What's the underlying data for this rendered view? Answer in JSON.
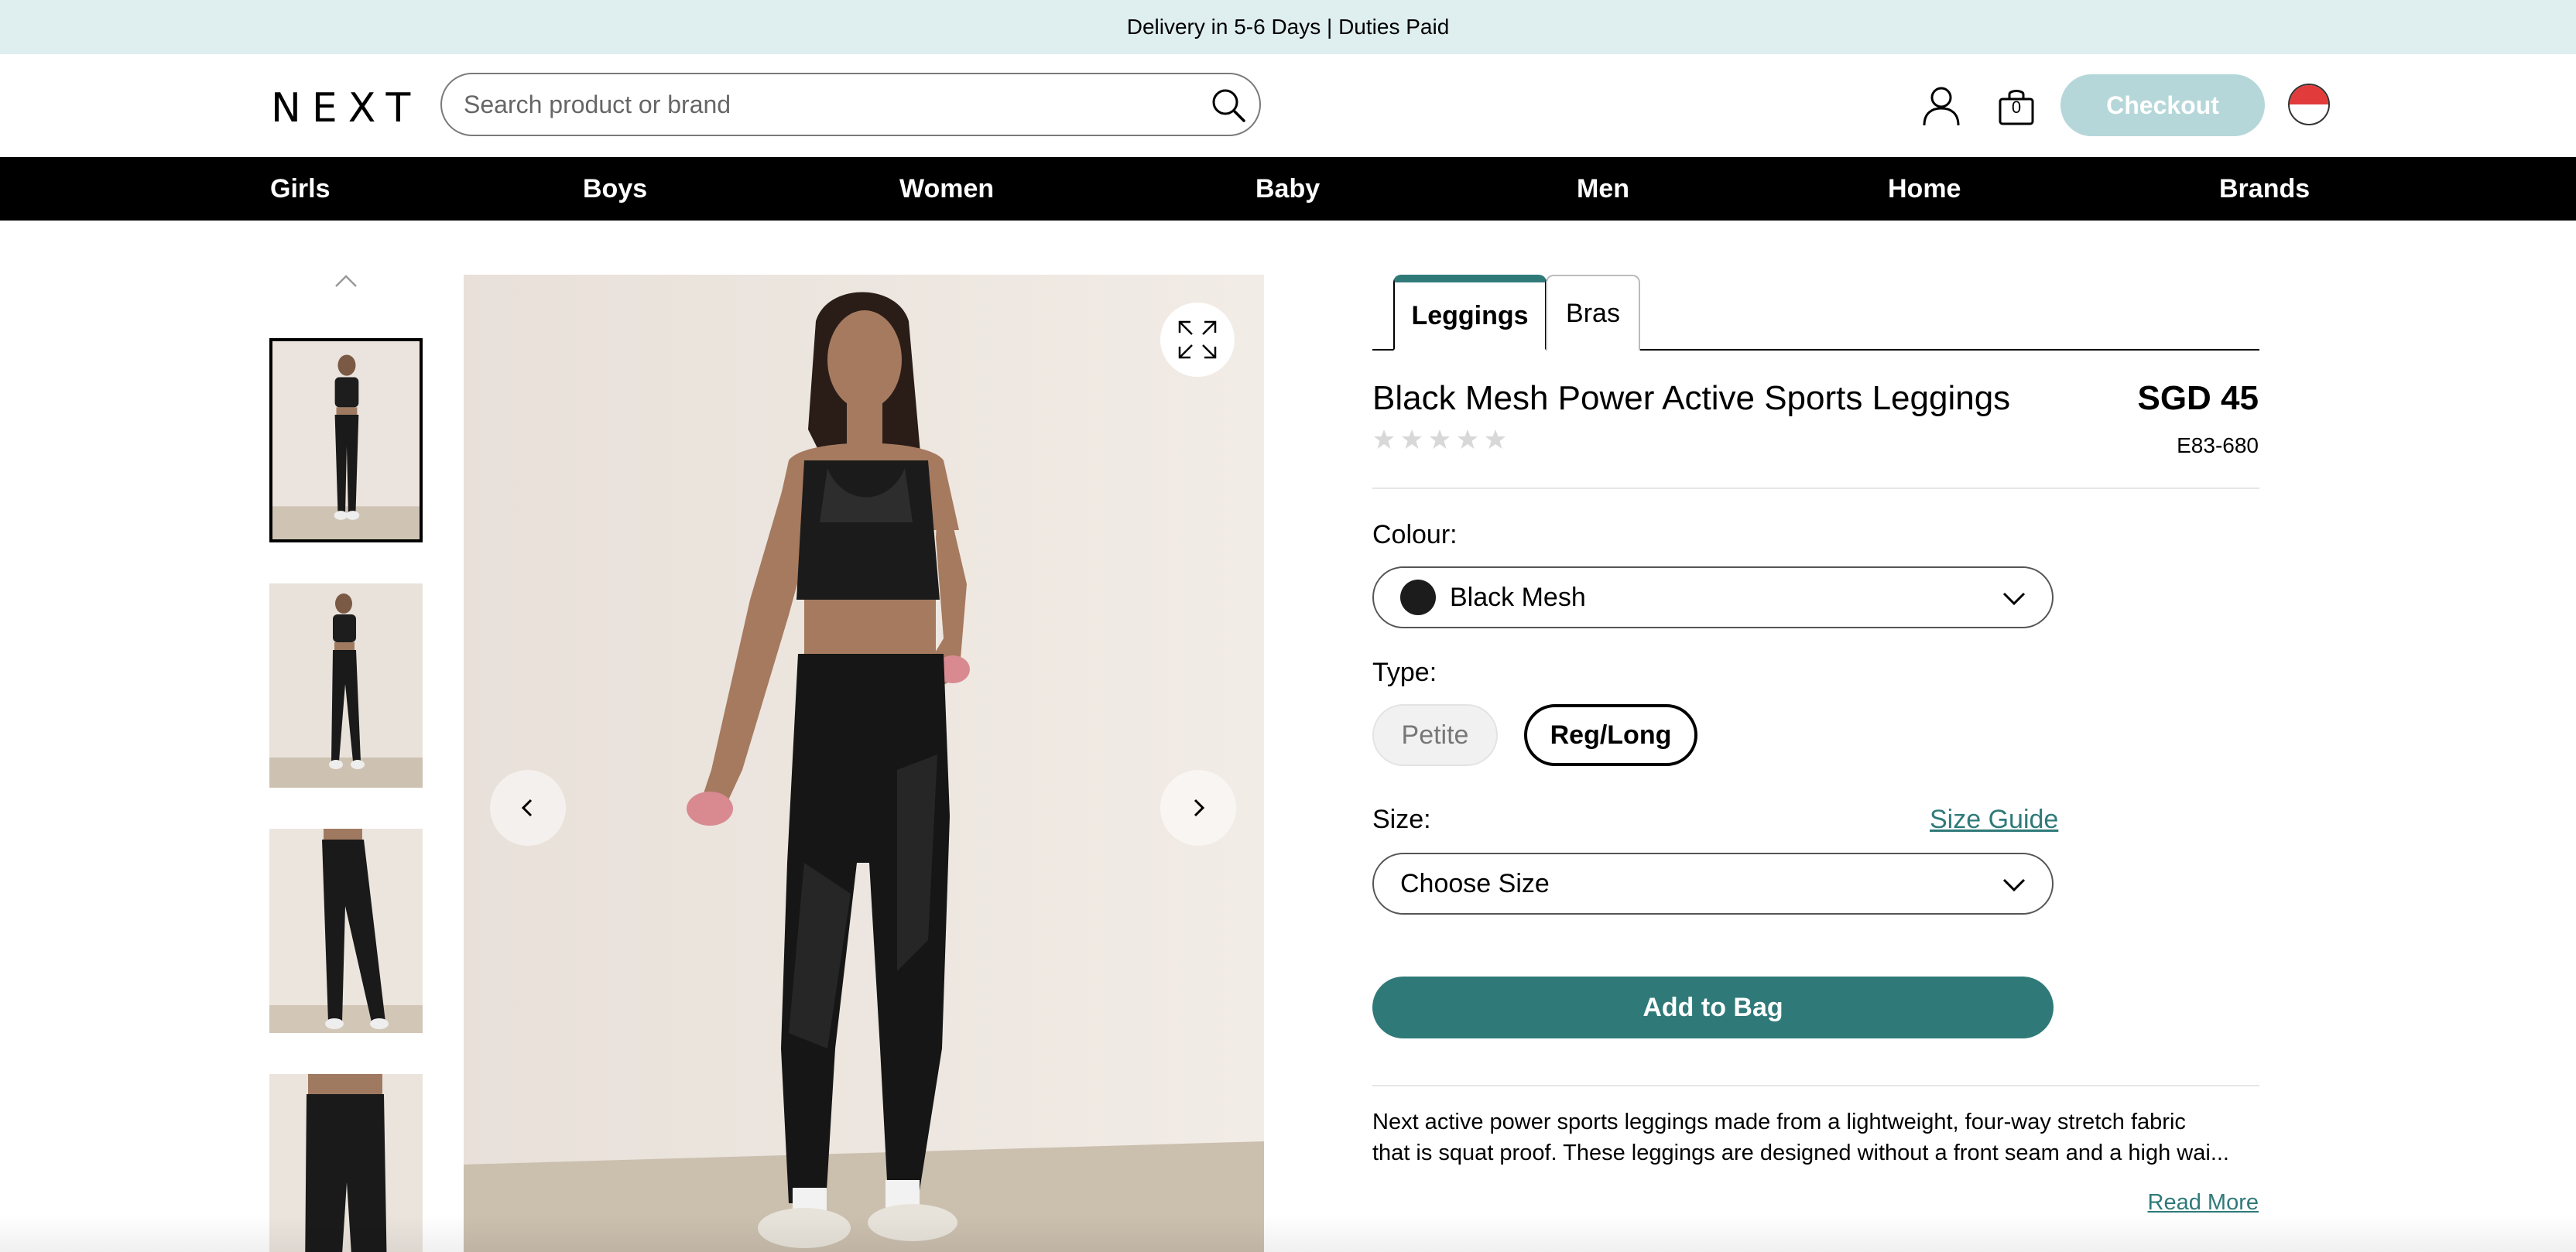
{
  "banner": {
    "text": "Delivery in 5-6 Days | Duties Paid"
  },
  "header": {
    "logo": "NEXT",
    "search_placeholder": "Search product or brand",
    "bag_count": "0",
    "checkout_label": "Checkout"
  },
  "nav": {
    "items": [
      {
        "label": "Girls"
      },
      {
        "label": "Boys"
      },
      {
        "label": "Women"
      },
      {
        "label": "Baby"
      },
      {
        "label": "Men"
      },
      {
        "label": "Home"
      },
      {
        "label": "Brands"
      }
    ]
  },
  "product": {
    "tabs": [
      {
        "label": "Leggings"
      },
      {
        "label": "Bras"
      }
    ],
    "title": "Black Mesh Power Active Sports Leggings",
    "price": "SGD 45",
    "sku": "E83-680",
    "rating_stars": 0,
    "colour_label": "Colour:",
    "colour_value": "Black Mesh",
    "colour_swatch": "#1c1c1c",
    "type_label": "Type:",
    "type_options": [
      {
        "label": "Petite"
      },
      {
        "label": "Reg/Long"
      }
    ],
    "type_selected": "Reg/Long",
    "size_label": "Size:",
    "size_guide": "Size Guide",
    "size_placeholder": "Choose Size",
    "add_to_bag": "Add to Bag",
    "description_line1": "Next active power sports leggings made from a lightweight, four-way stretch fabric",
    "description_line2": "that is squat proof. These leggings are designed without a front seam and a high wai...",
    "read_more": "Read More"
  },
  "colors": {
    "accent": "#2f7a79",
    "banner_bg": "#dfeeef",
    "checkout_bg": "#b6d7d9",
    "nav_bg": "#000000"
  }
}
